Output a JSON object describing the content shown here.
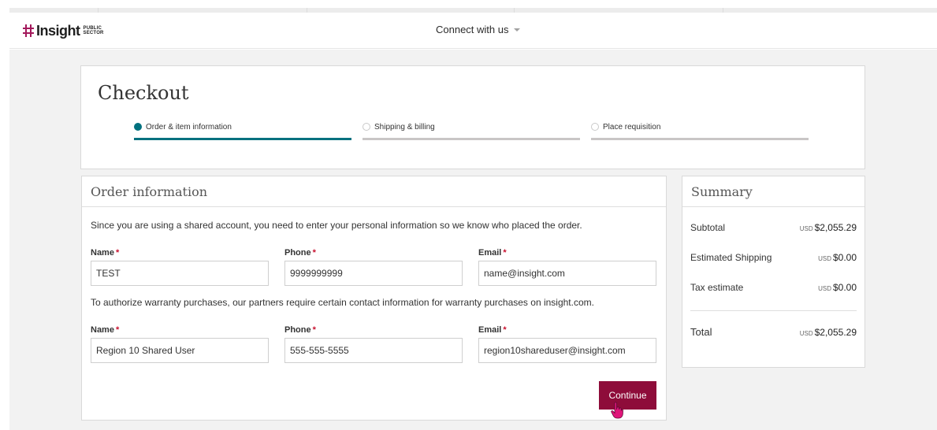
{
  "header": {
    "logo_text": "Insight",
    "logo_sub_1": "PUBLIC",
    "logo_sub_2": "SECTOR",
    "connect_label": "Connect with us"
  },
  "checkout": {
    "title": "Checkout",
    "steps": [
      {
        "label": "Order & item information",
        "active": true
      },
      {
        "label": "Shipping & billing",
        "active": false
      },
      {
        "label": "Place requisition",
        "active": false
      }
    ]
  },
  "order": {
    "title": "Order information",
    "shared_note": "Since you are using a shared account, you need to enter your personal information so we know who placed the order.",
    "personal": {
      "name_label": "Name",
      "name_value": "TEST",
      "phone_label": "Phone",
      "phone_value": "9999999999",
      "email_label": "Email",
      "email_value": "name@insight.com"
    },
    "warranty_note": "To authorize warranty purchases, our partners require certain contact information for warranty purchases on insight.com.",
    "warranty": {
      "name_label": "Name",
      "name_value": "Region 10 Shared User",
      "phone_label": "Phone",
      "phone_value": "555-555-5555",
      "email_label": "Email",
      "email_value": "region10shareduser@insight.com"
    },
    "required_marker": "*",
    "continue_label": "Continue"
  },
  "summary": {
    "title": "Summary",
    "currency": "USD",
    "rows": [
      {
        "label": "Subtotal",
        "amount": "$2,055.29"
      },
      {
        "label": "Estimated Shipping",
        "amount": "$0.00"
      },
      {
        "label": "Tax estimate",
        "amount": "$0.00"
      }
    ],
    "total_label": "Total",
    "total_amount": "$2,055.29"
  },
  "colors": {
    "brand": "#a3195b",
    "step_active": "#00717f",
    "button": "#8e0c3a",
    "required": "#c8102e"
  }
}
